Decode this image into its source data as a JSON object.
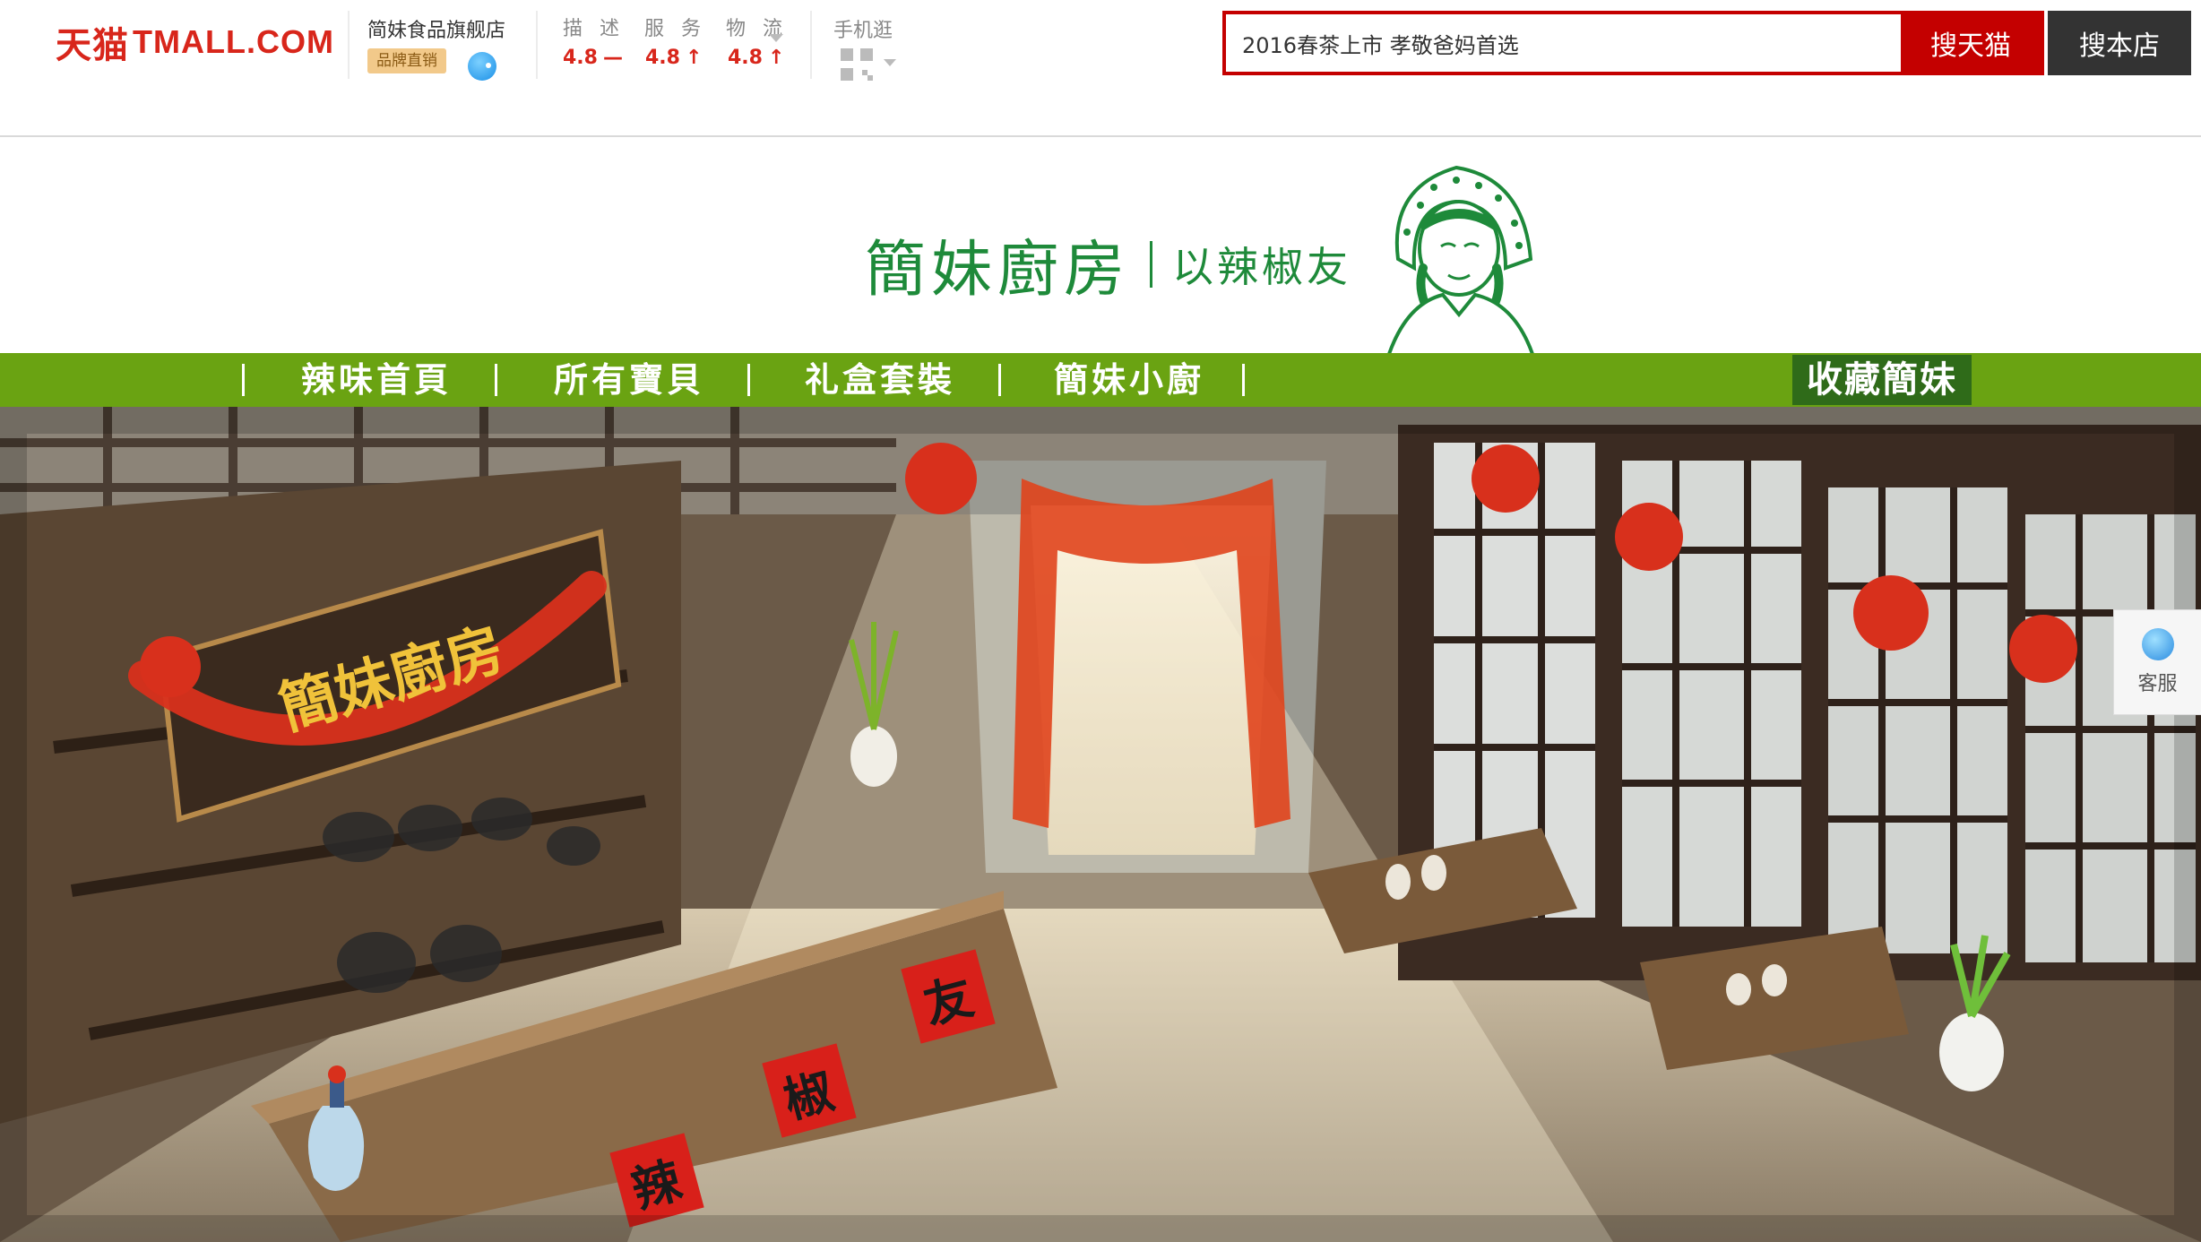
{
  "topbar": {
    "logo_cn": "天猫",
    "logo_en": "TMALL.COM",
    "shop_name": "简妹食品旗舰店",
    "brand_badge": "品牌直销",
    "ratings": {
      "labels": [
        "描 述",
        "服 务",
        "物 流"
      ],
      "values": [
        {
          "score": "4.8",
          "trend": "—"
        },
        {
          "score": "4.8",
          "trend": "↑"
        },
        {
          "score": "4.8",
          "trend": "↑"
        }
      ]
    },
    "mobile_label": "手机逛",
    "search": {
      "value": "2016春茶上市 孝敬爸妈首选",
      "search_tmall_label": "搜天猫",
      "search_shop_label": "搜本店"
    },
    "accent_color": "#c40000"
  },
  "banner": {
    "title": "簡妹廚房",
    "slogan": "以辣椒友",
    "color": "#1e8a3a"
  },
  "nav": {
    "items": [
      "辣味首頁",
      "所有寶貝",
      "礼盒套裝",
      "簡妹小廚"
    ],
    "favorite_label": "收藏簡妹",
    "color": "#6aa312"
  },
  "hero": {
    "sign_text": "簡妹廚房",
    "couplet_chars": [
      "友",
      "椒",
      "辣"
    ]
  },
  "service": {
    "label": "客服"
  }
}
